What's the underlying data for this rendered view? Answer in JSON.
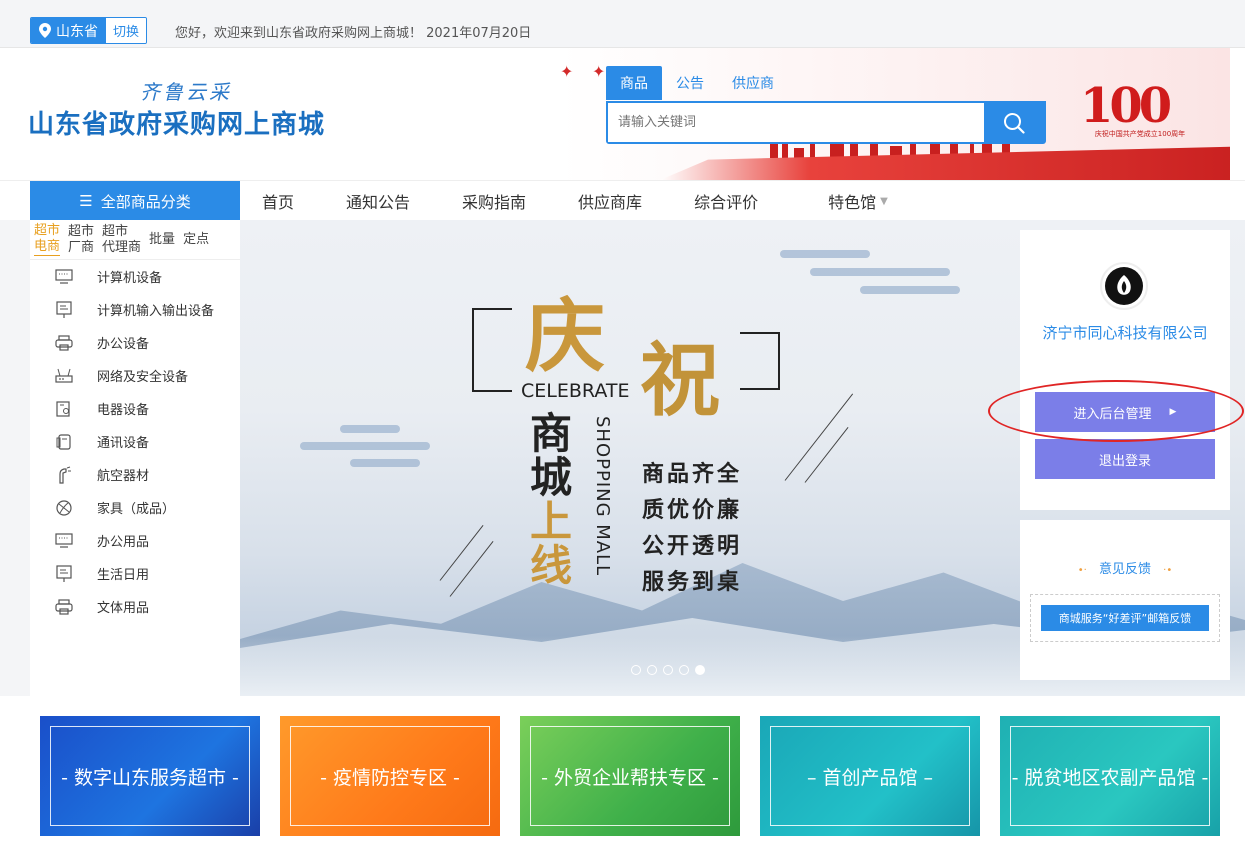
{
  "topbar": {
    "province": "山东省",
    "switch_label": "切换",
    "welcome": "您好，欢迎来到山东省政府采购网上商城！ 2021年07月20日"
  },
  "header": {
    "slogan": "齐鲁云采",
    "title": "山东省政府采购网上商城",
    "centennial_number": "100",
    "centennial_caption": "庆祝中国共产党成立100周年"
  },
  "search": {
    "tabs": [
      "商品",
      "公告",
      "供应商"
    ],
    "active_tab": 0,
    "placeholder": "请输入关键词"
  },
  "nav": {
    "all_categories": "全部商品分类",
    "links": [
      "首页",
      "通知公告",
      "采购指南",
      "供应商库",
      "综合评价",
      "特色馆"
    ]
  },
  "sidebar": {
    "types": [
      {
        "line1": "超市",
        "line2": "电商"
      },
      {
        "line1": "超市",
        "line2": "厂商"
      },
      {
        "line1": "超市",
        "line2": "代理商"
      },
      {
        "line1": "批量",
        "line2": ""
      },
      {
        "line1": "定点",
        "line2": ""
      }
    ],
    "categories": [
      {
        "label": "计算机设备",
        "icon": "monitor-icon"
      },
      {
        "label": "计算机输入输出设备",
        "icon": "terminal-icon"
      },
      {
        "label": "办公设备",
        "icon": "printer-icon"
      },
      {
        "label": "网络及安全设备",
        "icon": "router-icon"
      },
      {
        "label": "电器设备",
        "icon": "appliance-icon"
      },
      {
        "label": "通讯设备",
        "icon": "phone-icon"
      },
      {
        "label": "航空器材",
        "icon": "aircraft-icon"
      },
      {
        "label": "家具（成品）",
        "icon": "furniture-icon"
      },
      {
        "label": "办公用品",
        "icon": "monitor-icon"
      },
      {
        "label": "生活日用",
        "icon": "terminal-icon"
      },
      {
        "label": "文体用品",
        "icon": "printer-icon"
      }
    ]
  },
  "hero": {
    "char1": "庆",
    "char2": "祝",
    "celebrate": "CELEBRATE",
    "vertical_chars": [
      "商",
      "城",
      "上",
      "线"
    ],
    "shopping_mall": "SHOPPING MALL",
    "taglines": [
      "商品齐全",
      "质优价廉",
      "公开透明",
      "服务到桌"
    ],
    "slide_count": 5,
    "active_slide": 4
  },
  "user_panel": {
    "company": "济宁市同心科技有限公司",
    "admin_button": "进入后台管理",
    "logout_button": "退出登录"
  },
  "feedback": {
    "title": "意见反馈",
    "button": "商城服务“好差评”邮箱反馈"
  },
  "tiles": [
    "- 数字山东服务超市 -",
    "- 疫情防控专区 -",
    "- 外贸企业帮扶专区 -",
    "– 首创产品馆 –",
    "- 脱贫地区农副产品馆 -"
  ],
  "colors": {
    "primary": "#2b8be6",
    "button_purple": "#7b7ee8",
    "highlight_red": "#e02525",
    "gold": "#c9973c"
  }
}
